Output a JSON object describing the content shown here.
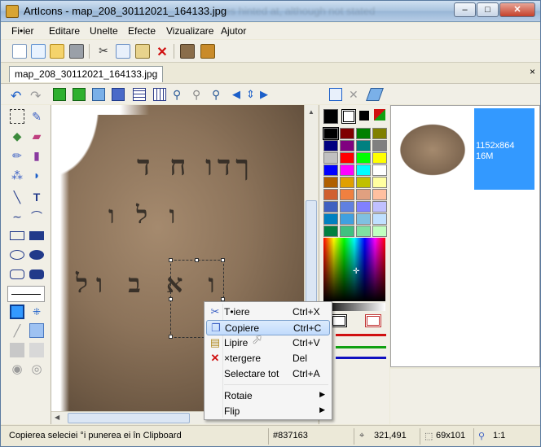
{
  "window": {
    "title": "ArtIcons - map_208_30112021_164133.jpg",
    "title_blurred": "res hinted at, although not stated"
  },
  "window_buttons": {
    "minimize": "–",
    "maximize": "□",
    "close": "✕"
  },
  "menu": [
    "Fi•ier",
    "Editare",
    "Unelte",
    "Efecte",
    "Vizualizare",
    "Ajutor"
  ],
  "doc_tab": {
    "label": "map_208_30112021_164133.jpg",
    "close": "×"
  },
  "thumbnail": {
    "dimensions": "1152x864",
    "size": "16M"
  },
  "context_menu": {
    "items": [
      {
        "label": "T•iere",
        "shortcut": "Ctrl+X",
        "icon": "scissors-icon"
      },
      {
        "label": "Copiere",
        "shortcut": "Ctrl+C",
        "icon": "copy-icon",
        "highlighted": true
      },
      {
        "label": "Lipire",
        "shortcut": "Ctrl+V",
        "icon": "paste-icon"
      },
      {
        "label": "×tergere",
        "shortcut": "Del",
        "icon": "delete-icon"
      },
      {
        "label": "Selectare tot",
        "shortcut": "Ctrl+A",
        "icon": ""
      }
    ],
    "submenus": [
      {
        "label": "Rotaie"
      },
      {
        "label": "Flip"
      }
    ]
  },
  "status": {
    "message": "Copierea seleciei °i punerea ei în Clipboard",
    "color": "#837163",
    "position": "321,491",
    "selection_size": "69x101",
    "zoom": "1:1"
  },
  "palette": {
    "colors": [
      "#000000",
      "#800000",
      "#008000",
      "#808000",
      "#000080",
      "#800080",
      "#008080",
      "#808080",
      "#c0c0c0",
      "#ff0000",
      "#00ff00",
      "#ffff00",
      "#0000ff",
      "#ff00ff",
      "#00ffff",
      "#ffffff",
      "#b06000",
      "#e0a000",
      "#c0c000",
      "#ffffa0",
      "#d06030",
      "#f08040",
      "#e0a080",
      "#ffc0a0",
      "#4060c0",
      "#6080e0",
      "#8080ff",
      "#c0c0ff",
      "#0080c0",
      "#40a0e0",
      "#80c0e0",
      "#c0e0ff",
      "#008040",
      "#40c080",
      "#80e0a0",
      "#c0ffc0"
    ]
  }
}
